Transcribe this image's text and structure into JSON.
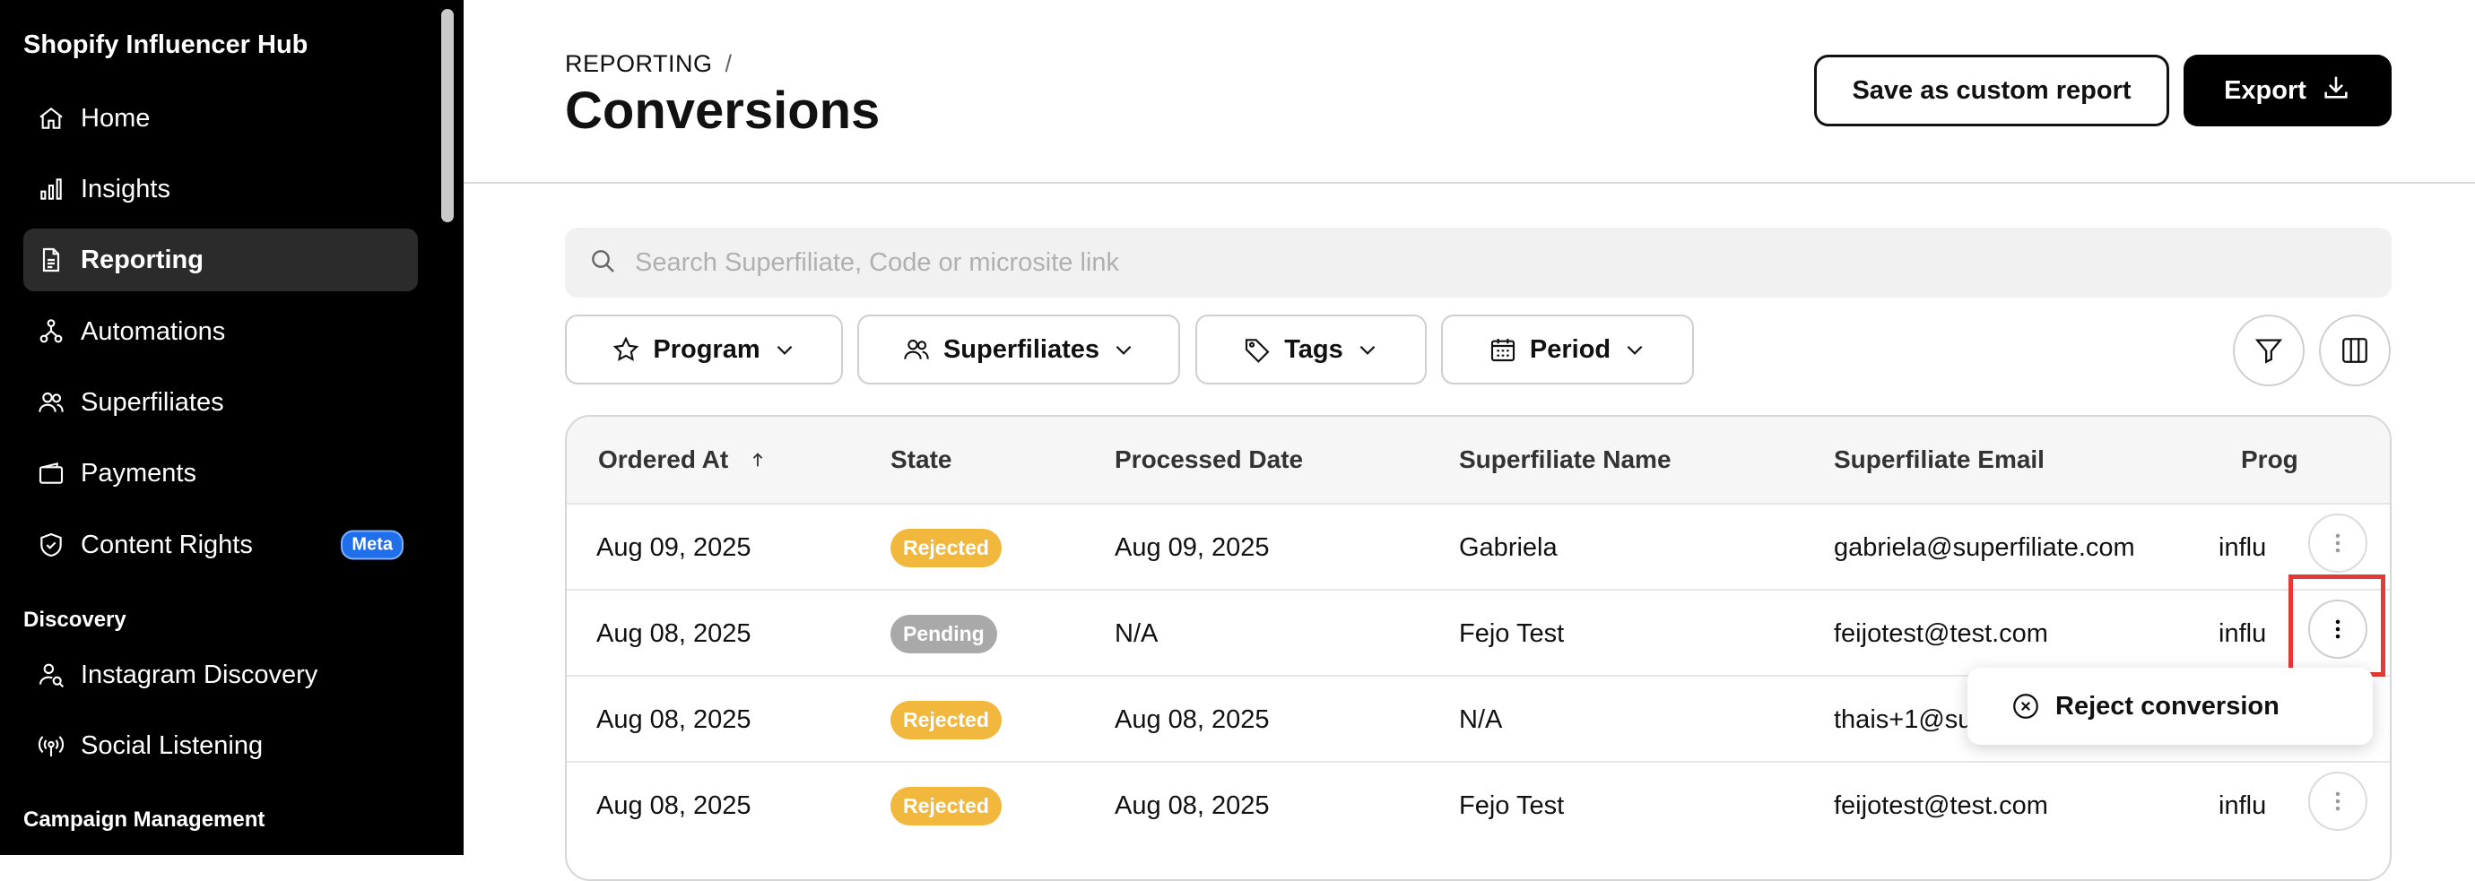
{
  "sidebar": {
    "brand": "Shopify Influencer Hub",
    "items": [
      {
        "label": "Home",
        "icon": "home-icon"
      },
      {
        "label": "Insights",
        "icon": "bar-chart-icon"
      },
      {
        "label": "Reporting",
        "icon": "document-icon",
        "active": true
      },
      {
        "label": "Automations",
        "icon": "automation-icon"
      },
      {
        "label": "Superfiliates",
        "icon": "users-icon"
      },
      {
        "label": "Payments",
        "icon": "wallet-icon"
      },
      {
        "label": "Content Rights",
        "icon": "shield-icon",
        "badge": "Meta"
      }
    ],
    "sections": [
      {
        "label": "Discovery",
        "items": [
          {
            "label": "Instagram Discovery",
            "icon": "user-search-icon"
          },
          {
            "label": "Social Listening",
            "icon": "broadcast-icon"
          }
        ]
      },
      {
        "label": "Campaign Management",
        "items": []
      }
    ]
  },
  "header": {
    "breadcrumb": "REPORTING",
    "breadcrumb_separator": "/",
    "title": "Conversions",
    "save_button": "Save as custom report",
    "export_button": "Export"
  },
  "search": {
    "placeholder": "Search Superfiliate, Code or microsite link"
  },
  "filters": [
    {
      "label": "Program",
      "icon": "star-icon"
    },
    {
      "label": "Superfiliates",
      "icon": "users-icon"
    },
    {
      "label": "Tags",
      "icon": "tag-icon"
    },
    {
      "label": "Period",
      "icon": "calendar-icon"
    }
  ],
  "table": {
    "columns": [
      "Ordered At",
      "State",
      "Processed Date",
      "Superfiliate Name",
      "Superfiliate Email",
      "Prog"
    ],
    "rows": [
      {
        "ordered_at": "Aug 09, 2025",
        "state": "Rejected",
        "processed": "Aug 09, 2025",
        "name": "Gabriela",
        "email": "gabriela@superfiliate.com",
        "program": "influ"
      },
      {
        "ordered_at": "Aug 08, 2025",
        "state": "Pending",
        "processed": "N/A",
        "name": "Fejo Test",
        "email": "feijotest@test.com",
        "program": "influ"
      },
      {
        "ordered_at": "Aug 08, 2025",
        "state": "Rejected",
        "processed": "Aug 08, 2025",
        "name": "N/A",
        "email": "thais+1@sup",
        "program": ""
      },
      {
        "ordered_at": "Aug 08, 2025",
        "state": "Rejected",
        "processed": "Aug 08, 2025",
        "name": "Fejo Test",
        "email": "feijotest@test.com",
        "program": "influ"
      }
    ]
  },
  "row_menu": {
    "reject_label": "Reject conversion"
  },
  "colors": {
    "rejected": "#f2b73d",
    "pending": "#a9a9a9",
    "highlight": "#e53935",
    "meta_badge": "#1f6feb"
  }
}
